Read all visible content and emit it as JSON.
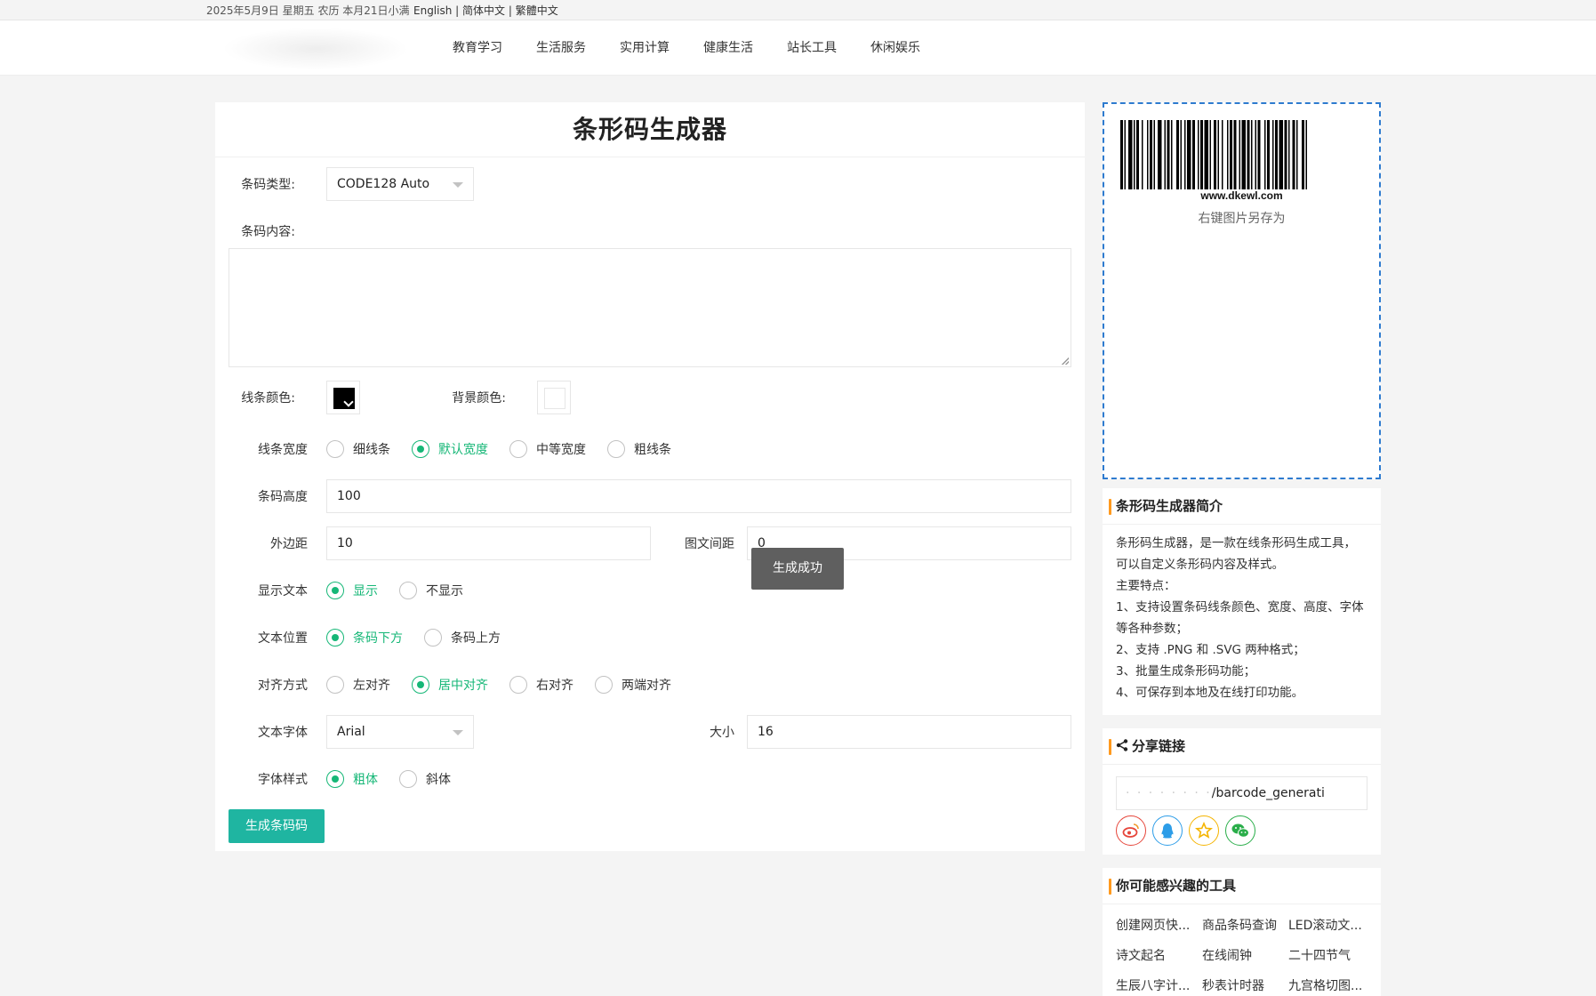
{
  "topbar": {
    "date": "2025年5月9日 星期五 农历 本月21日小满",
    "lang_en": "English",
    "sep1": " | ",
    "lang_cn": "简体中文",
    "sep2": " | ",
    "lang_tw": "繁體中文"
  },
  "nav": [
    "教育学习",
    "生活服务",
    "实用计算",
    "健康生活",
    "站长工具",
    "休闲娱乐"
  ],
  "form": {
    "title": "条形码生成器",
    "type_label": "条码类型:",
    "type_value": "CODE128 Auto",
    "content_label": "条码内容:",
    "content_value": "",
    "line_color_label": "线条颜色:",
    "line_color": "#000000",
    "bg_color_label": "背景颜色:",
    "bg_color": "#ffffff",
    "width_label": "线条宽度",
    "width_options": [
      "细线条",
      "默认宽度",
      "中等宽度",
      "粗线条"
    ],
    "width_selected": "默认宽度",
    "height_label": "条码高度",
    "height_value": "100",
    "margin_label": "外边距",
    "margin_value": "10",
    "textmargin_label": "图文间距",
    "textmargin_value": "0",
    "showtext_label": "显示文本",
    "showtext_options": [
      "显示",
      "不显示"
    ],
    "showtext_selected": "显示",
    "textpos_label": "文本位置",
    "textpos_options": [
      "条码下方",
      "条码上方"
    ],
    "textpos_selected": "条码下方",
    "align_label": "对齐方式",
    "align_options": [
      "左对齐",
      "居中对齐",
      "右对齐",
      "两端对齐"
    ],
    "align_selected": "居中对齐",
    "font_label": "文本字体",
    "font_value": "Arial",
    "size_label": "大小",
    "size_value": "16",
    "fontstyle_label": "字体样式",
    "fontstyle_options": [
      "粗体",
      "斜体"
    ],
    "fontstyle_selected": "粗体",
    "generate_button": "生成条码码",
    "toast": "生成成功"
  },
  "preview": {
    "barcode_text": "www.dkewl.com",
    "tip": "右键图片另存为"
  },
  "intro": {
    "title": "条形码生成器简介",
    "lines": [
      "条形码生成器，是一款在线条形码生成工具，可以自定义条形码内容及样式。",
      "主要特点：",
      "1、支持设置条码线条颜色、宽度、高度、字体等各种参数；",
      "2、支持 .PNG 和 .SVG 两种格式；",
      "3、批量生成条形码功能；",
      "4、可保存到本地及在线打印功能。"
    ]
  },
  "share": {
    "title": "分享链接",
    "url_visible": "/barcode_generati",
    "icons": [
      "weibo-icon",
      "qq-icon",
      "qzone-icon",
      "wechat-icon"
    ]
  },
  "related": {
    "title": "你可能感兴趣的工具",
    "items": [
      "创建网页快...",
      "商品条码查询",
      "LED滚动文...",
      "诗文起名",
      "在线闹钟",
      "二十四节气",
      "生辰八字计...",
      "秒表计时器",
      "九宫格切图..."
    ]
  },
  "colors": {
    "accent_green": "#16b777",
    "button_teal": "#1fb5a1",
    "preview_border": "#2e7bcf",
    "section_bar": "#ff9a1e"
  }
}
